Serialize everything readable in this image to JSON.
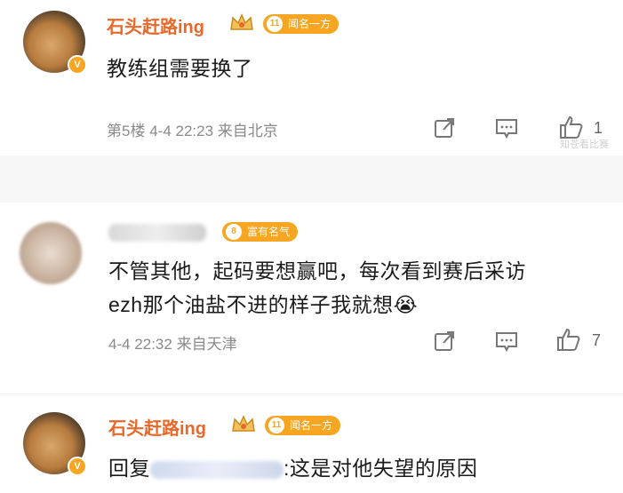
{
  "comments": [
    {
      "username": "石头赶路ing",
      "tag_icon": "11",
      "tag": "闻名一方",
      "text": "教练组需要换了",
      "floor": "第5楼",
      "datetime": "4-4 22:23",
      "location": "来自北京",
      "likes": "1",
      "verified": "V"
    },
    {
      "tag_icon": "8",
      "tag": "富有名气",
      "text_line1": "不管其他，起码要想赢吧，每次看到赛后采访",
      "text_line2": "ezh那个油盐不进的样子我就想😭",
      "datetime": "4-4 22:32",
      "location": "来自天津",
      "likes": "7"
    },
    {
      "username": "石头赶路ing",
      "tag_icon": "11",
      "tag": "闻名一方",
      "reply_prefix": "回复",
      "reply_text": ":这是对他失望的原因",
      "verified": "V"
    }
  ],
  "watermark": "知苍看比赛",
  "colors": {
    "username": "#e8682a",
    "badge": "#f6a623",
    "meta": "#8a8a8a"
  }
}
